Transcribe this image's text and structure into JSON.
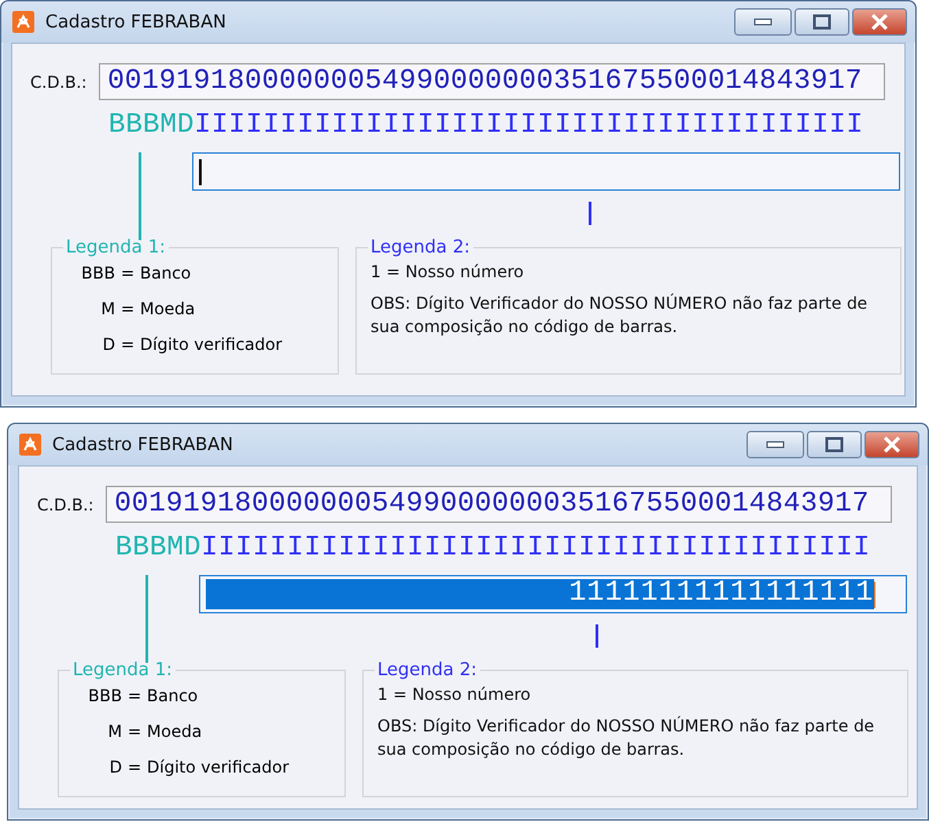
{
  "windows": [
    {
      "title": "Cadastro FEBRABAN",
      "cdb_label": "C.D.B.:",
      "cdb_value": "00191918000000054990000000351675500014843917",
      "segments": [
        {
          "text": "BBBMD",
          "color": "#1fb5b0"
        },
        {
          "text": "IIIIIIIIIIIIIIIIIIIIIIIIIIIIIIIIIIIIIII",
          "color": "#2f2ff5"
        }
      ],
      "field": {
        "focused": true,
        "text_selected": false
      },
      "legend_1": {
        "title": "Legenda 1:",
        "color": "#1fb5b0",
        "entries": [
          {
            "code": "BBB",
            "sign": "=",
            "meaning": "Banco"
          },
          {
            "code": "M",
            "sign": "=",
            "meaning": "Moeda"
          },
          {
            "code": "D",
            "sign": "=",
            "meaning": "Dígito verificador"
          }
        ]
      },
      "legend_2": {
        "title": "Legenda 2:",
        "color": "#2f2ff5",
        "lines": [
          "1 = Nosso número",
          "OBS: Dígito Verificador do NOSSO NÚMERO não faz parte de sua composição no código de barras."
        ]
      }
    },
    {
      "title": "Cadastro FEBRABAN",
      "cdb_label": "C.D.B.:",
      "cdb_value": "00191918000000054990000000351675500014843917",
      "segments": [
        {
          "text": "BBBMD",
          "color": "#1fb5b0"
        },
        {
          "text": "IIIIIIIIIIIIIIIIIIIIIIIIIIIIIIIIIIIIIII",
          "color": "#2f2ff5"
        }
      ],
      "field": {
        "value": "11111111111111111",
        "focused": true,
        "text_selected": true
      },
      "legend_1": {
        "title": "Legenda 1:",
        "color": "#1fb5b0",
        "entries": [
          {
            "code": "BBB",
            "sign": "=",
            "meaning": "Banco"
          },
          {
            "code": "M",
            "sign": "=",
            "meaning": "Moeda"
          },
          {
            "code": "D",
            "sign": "=",
            "meaning": "Dígito verificador"
          }
        ]
      },
      "legend_2": {
        "title": "Legenda 2:",
        "color": "#2f2ff5",
        "lines": [
          "1 = Nosso número",
          "OBS: Dígito Verificador do NOSSO NÚMERO não faz parte de sua composição no código de barras."
        ]
      }
    }
  ]
}
